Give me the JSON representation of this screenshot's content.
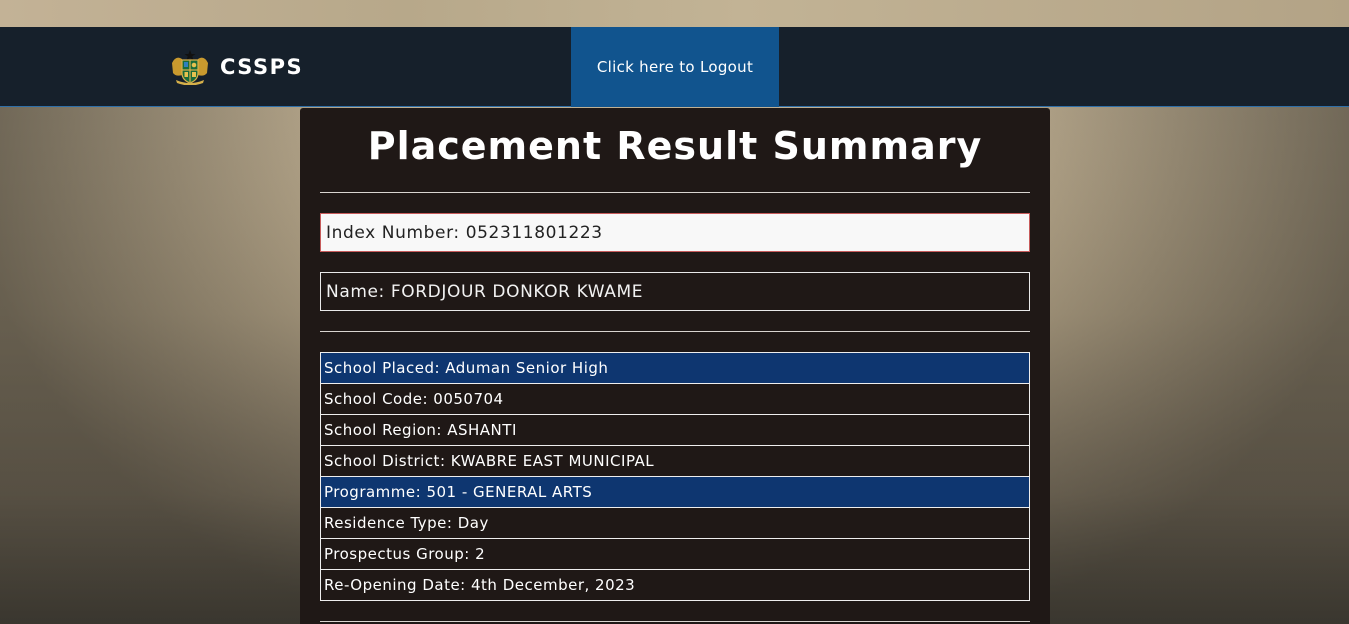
{
  "navbar": {
    "brand_name": "CSSPS",
    "logout_label": "Click here to Logout"
  },
  "summary": {
    "title": "Placement Result Summary",
    "index_number": "Index Number: 052311801223",
    "name": "Name: FORDJOUR DONKOR KWAME"
  },
  "details": [
    {
      "text": "School Placed: Aduman Senior High",
      "highlight": true
    },
    {
      "text": "School Code: 0050704",
      "highlight": false
    },
    {
      "text": "School Region: ASHANTI",
      "highlight": false
    },
    {
      "text": "School District: KWABRE EAST MUNICIPAL",
      "highlight": false
    },
    {
      "text": "Programme: 501 - GENERAL ARTS",
      "highlight": true
    },
    {
      "text": "Residence Type: Day",
      "highlight": false
    },
    {
      "text": "Prospectus Group: 2",
      "highlight": false
    },
    {
      "text": "Re-Opening Date: 4th December, 2023",
      "highlight": false
    }
  ],
  "colors": {
    "navbar_bg": "#16202b",
    "logout_bg": "#11548e",
    "card_bg": "#1f1816",
    "highlight_row": "#0e3670"
  },
  "icons": {
    "brand_logo": "ghana-coat-of-arms-icon"
  }
}
